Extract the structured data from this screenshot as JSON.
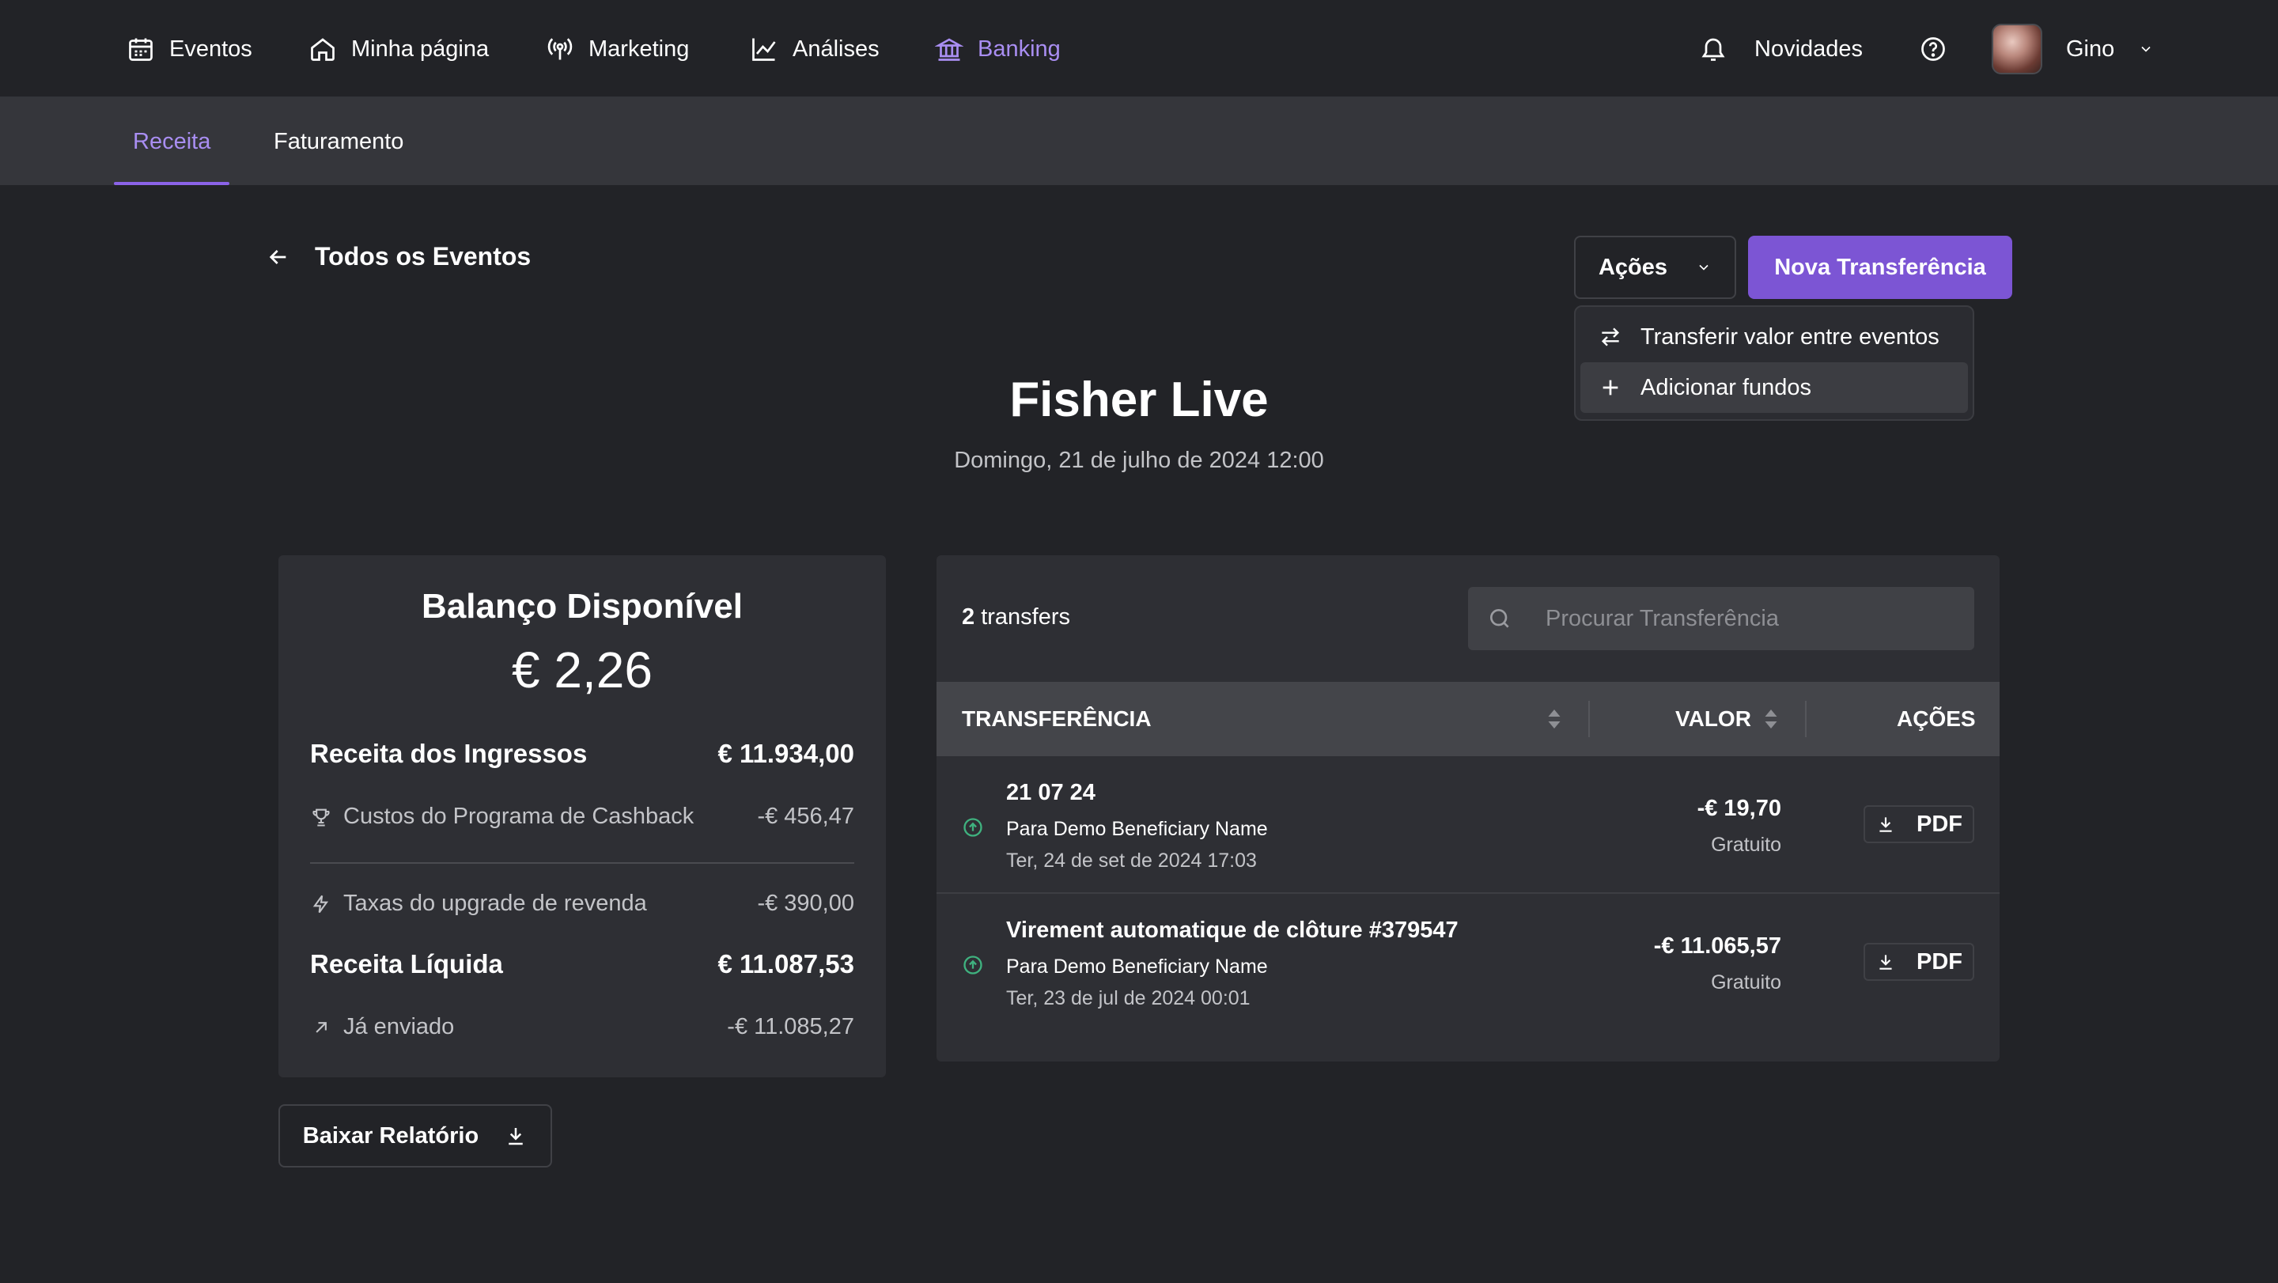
{
  "nav": {
    "items": [
      {
        "label": "Eventos",
        "icon": "calendar-icon"
      },
      {
        "label": "Minha página",
        "icon": "home-icon"
      },
      {
        "label": "Marketing",
        "icon": "broadcast-icon"
      },
      {
        "label": "Análises",
        "icon": "chart-line-icon"
      },
      {
        "label": "Banking",
        "icon": "bank-icon",
        "active": true
      }
    ],
    "news_label": "Novidades",
    "user_name": "Gino"
  },
  "subnav": {
    "tabs": [
      {
        "label": "Receita",
        "active": true
      },
      {
        "label": "Faturamento",
        "active": false
      }
    ]
  },
  "page": {
    "back_label": "Todos os Eventos",
    "actions_label": "Ações",
    "new_transfer_label": "Nova Transferência",
    "actions_menu": [
      {
        "label": "Transferir valor entre eventos",
        "icon": "arrows-swap-icon"
      },
      {
        "label": "Adicionar fundos",
        "icon": "plus-icon"
      }
    ],
    "event_title": "Fisher Live",
    "event_date": "Domingo, 21 de julho de 2024 12:00"
  },
  "balance": {
    "title": "Balanço Disponível",
    "amount": "€ 2,26",
    "ticket_revenue_label": "Receita dos Ingressos",
    "ticket_revenue_value": "€ 11.934,00",
    "cashback_label": "Custos do Programa de Cashback",
    "cashback_value": "-€ 456,47",
    "resale_fee_label": "Taxas do upgrade de revenda",
    "resale_fee_value": "-€ 390,00",
    "net_revenue_label": "Receita Líquida",
    "net_revenue_value": "€ 11.087,53",
    "sent_label": "Já enviado",
    "sent_value": "-€ 11.085,27",
    "download_label": "Baixar Relatório"
  },
  "transfers": {
    "count": "2",
    "count_suffix": " transfers",
    "search_placeholder": "Procurar Transferência",
    "columns": {
      "transfer": "TRANSFERÊNCIA",
      "value": "VALOR",
      "actions": "AÇÕES"
    },
    "rows": [
      {
        "title": "21 07 24",
        "beneficiary": "Para Demo Beneficiary Name",
        "date": "Ter, 24 de set de 2024 17:03",
        "value": "-€ 19,70",
        "note": "Gratuito",
        "action": "PDF"
      },
      {
        "title": "Virement automatique de clôture #379547",
        "beneficiary": "Para Demo Beneficiary Name",
        "date": "Ter, 23 de jul de 2024 00:01",
        "value": "-€ 11.065,57",
        "note": "Gratuito",
        "action": "PDF"
      }
    ]
  },
  "colors": {
    "accent": "#7c55d4",
    "accent_text": "#a98ef2",
    "background": "#222327",
    "card": "#2e2f34",
    "status_green": "#3fb27f"
  }
}
